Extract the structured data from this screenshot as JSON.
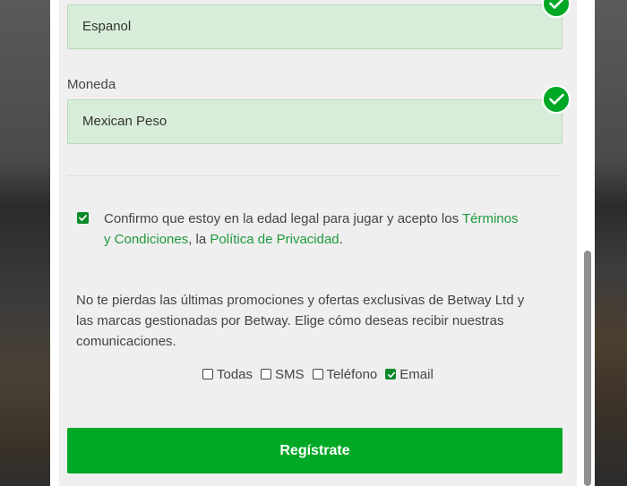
{
  "form": {
    "language_value": "Espanol",
    "currency_label": "Moneda",
    "currency_value": "Mexican Peso",
    "legal": {
      "checked": true,
      "prefix": "Confirmo que estoy en la edad legal para jugar y acepto los ",
      "terms_link": "Términos y Condiciones",
      "separator": ", la ",
      "privacy_link": "Política de Privacidad",
      "suffix": "."
    },
    "promo_text": "No te pierdas las últimas promociones y ofertas exclusivas de Betway Ltd y las marcas gestionadas por Betway. Elige cómo deseas recibir nuestras comunicaciones.",
    "channels": [
      {
        "label": "Todas",
        "checked": false
      },
      {
        "label": "SMS",
        "checked": false
      },
      {
        "label": "Teléfono",
        "checked": false
      },
      {
        "label": "Email",
        "checked": true
      }
    ],
    "submit_label": "Regístrate"
  },
  "colors": {
    "brand_green": "#00a826",
    "link_green": "#1f9a3e",
    "valid_field_bg": "#d8edd9"
  },
  "icons": {
    "valid": "checkmark-circle-icon",
    "checkbox_checked": "checkbox-checked-icon",
    "checkbox_unchecked": "checkbox-unchecked-icon"
  }
}
